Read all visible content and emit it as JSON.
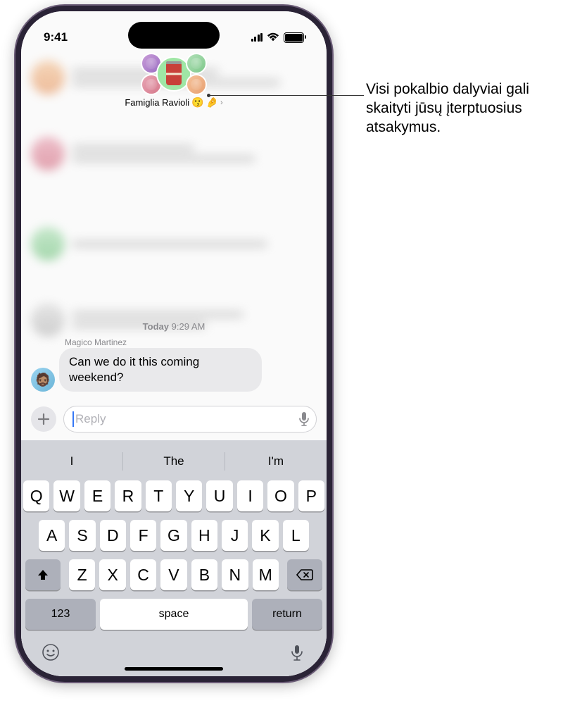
{
  "status_bar": {
    "time": "9:41"
  },
  "header": {
    "group_name": "Famiglia Ravioli",
    "emoji1": "😗",
    "emoji2": "🤌",
    "chevron": "›"
  },
  "timestamp": {
    "day": "Today",
    "time": "9:29 AM"
  },
  "message": {
    "sender": "Magico Martinez",
    "text": "Can we do it this coming weekend?"
  },
  "reply": {
    "placeholder": "Reply"
  },
  "suggestions": {
    "s1": "I",
    "s2": "The",
    "s3": "I'm"
  },
  "keyboard": {
    "row1": [
      "Q",
      "W",
      "E",
      "R",
      "T",
      "Y",
      "U",
      "I",
      "O",
      "P"
    ],
    "row2": [
      "A",
      "S",
      "D",
      "F",
      "G",
      "H",
      "J",
      "K",
      "L"
    ],
    "row3": [
      "Z",
      "X",
      "C",
      "V",
      "B",
      "N",
      "M"
    ],
    "key123": "123",
    "space": "space",
    "return": "return"
  },
  "callout": {
    "text": "Visi pokalbio dalyviai gali skaityti jūsų įterptuosius atsakymus."
  }
}
